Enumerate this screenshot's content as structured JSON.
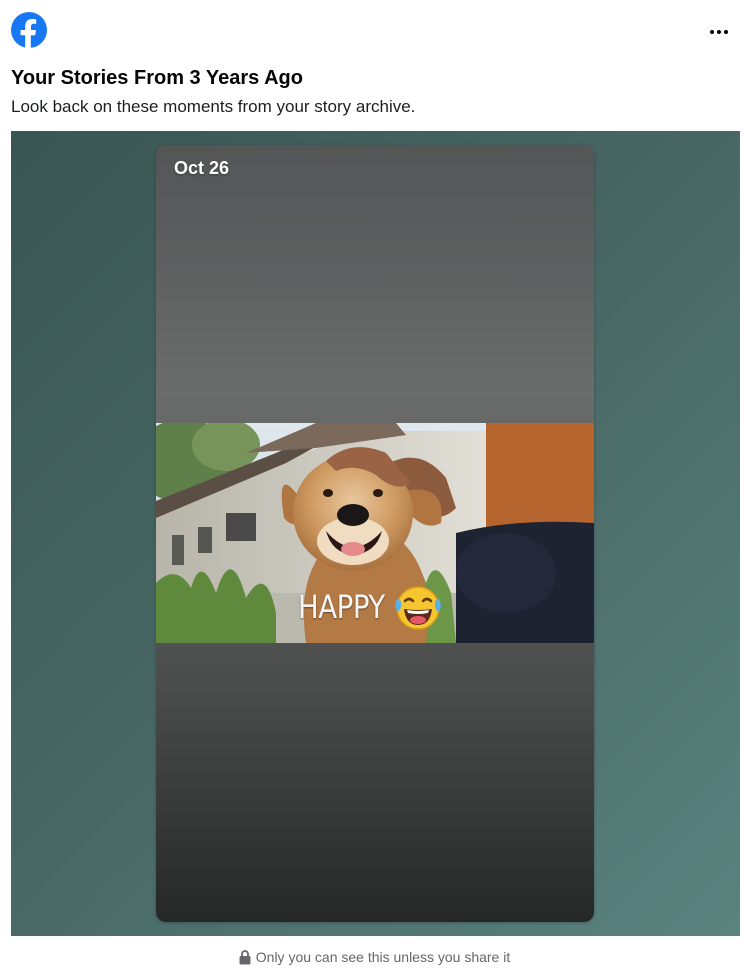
{
  "header": {
    "logo_icon": "facebook-logo-icon",
    "more_icon": "more-options-icon",
    "brand_color": "#1877F2"
  },
  "post": {
    "title": "Your Stories From 3 Years Ago",
    "subtitle": "Look back on these moments from your story archive."
  },
  "story": {
    "date": "Oct 26",
    "caption": "HAPPY",
    "emoji": "face-with-tears-of-joy"
  },
  "footer": {
    "privacy_text": "Only you can see this unless you share it",
    "privacy_icon": "lock-icon"
  }
}
